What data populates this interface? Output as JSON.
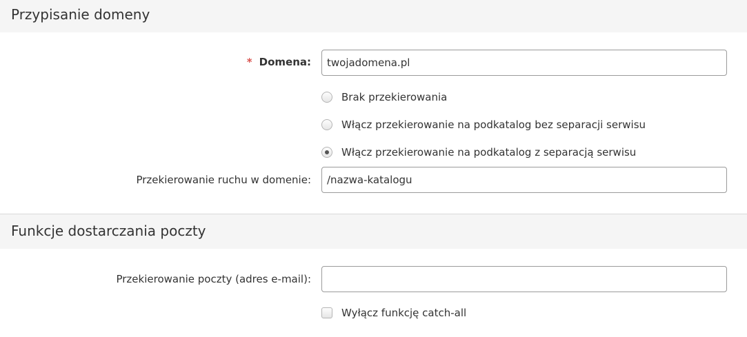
{
  "domain_section": {
    "title": "Przypisanie domeny",
    "domain_field": {
      "required_mark": "*",
      "label": "Domena:",
      "value": "twojadomena.pl"
    },
    "redirect_options": [
      {
        "label": "Brak przekierowania",
        "selected": false
      },
      {
        "label": "Włącz przekierowanie na podkatalog bez separacji serwisu",
        "selected": false
      },
      {
        "label": "Włącz przekierowanie na podkatalog z separacją serwisu",
        "selected": true
      }
    ],
    "traffic_redirect_field": {
      "label": "Przekierowanie ruchu w domenie:",
      "value": "/nazwa-katalogu"
    }
  },
  "mail_section": {
    "title": "Funkcje dostarczania poczty",
    "mail_redirect_field": {
      "label": "Przekierowanie poczty (adres e-mail):",
      "value": ""
    },
    "catch_all": {
      "label": "Wyłącz funkcję catch-all",
      "checked": false
    }
  }
}
